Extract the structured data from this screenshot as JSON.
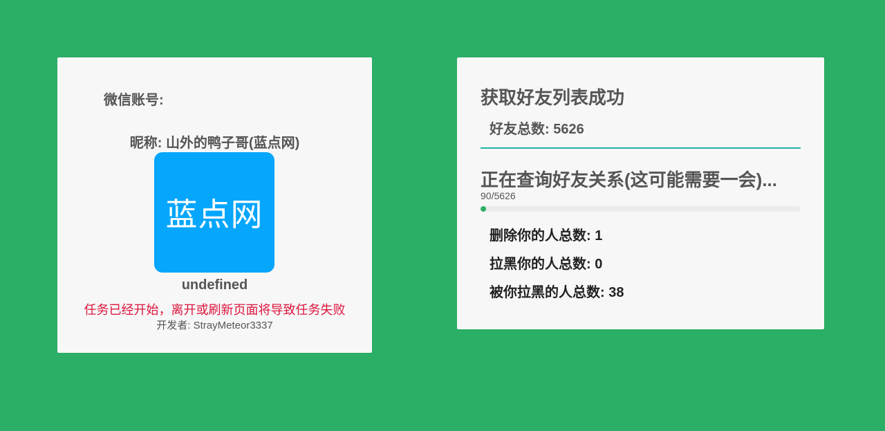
{
  "left_panel": {
    "account_label": "微信账号: ",
    "account_value": "",
    "nickname_label": "昵称: ",
    "nickname_value": "山外的鸭子哥(蓝点网)",
    "avatar_text": "蓝点网",
    "avatar_color": "#05a6fc",
    "wxid": "undefined",
    "warning": "任务已经开始，离开或刷新页面将导致任务失败",
    "developer_label": "开发者: ",
    "developer_value": "StrayMeteor3337"
  },
  "right_panel": {
    "title": "获取好友列表成功",
    "friend_total_label": "好友总数: ",
    "friend_total_value": "5626",
    "querying_text": "正在查询好友关系(这可能需要一会)...",
    "progress": {
      "text": "90/5626",
      "current": 90,
      "total": 5626
    },
    "stats": [
      {
        "label": "删除你的人总数: ",
        "value": "1"
      },
      {
        "label": "拉黑你的人总数: ",
        "value": "0"
      },
      {
        "label": "被你拉黑的人总数: ",
        "value": "38"
      }
    ]
  },
  "colors": {
    "background": "#2bae66",
    "card": "#f7f7f7",
    "divider": "#20b2aa",
    "warning": "#dc143c",
    "progress_fill": "#2bae66"
  }
}
